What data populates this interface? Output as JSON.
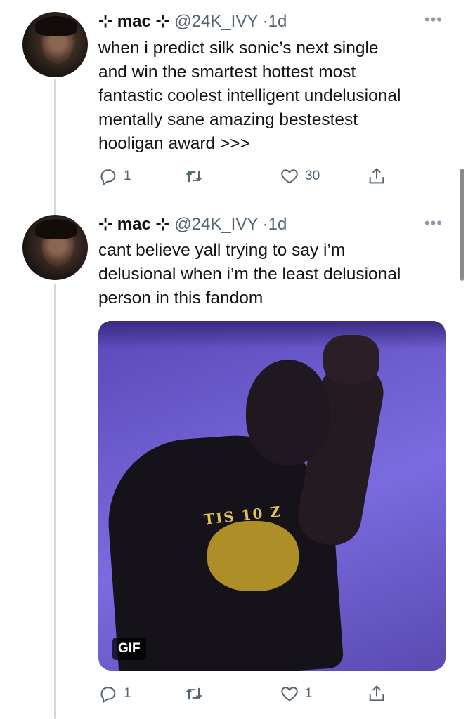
{
  "tweets": [
    {
      "name": "⊹ mac ⊹",
      "handle": "@24K_IVY",
      "separator": "·",
      "time": "1d",
      "more": "•••",
      "text": "when i predict silk sonic’s next single\nand win the smartest hottest most\nfantastic coolest intelligent undelusional\nmentally sane amazing bestestest\nhooligan award >>>",
      "replies": "1",
      "retweets": "",
      "likes": "30"
    },
    {
      "name": "⊹ mac ⊹",
      "handle": "@24K_IVY",
      "separator": "·",
      "time": "1d",
      "more": "•••",
      "text": "cant believe yall trying to say i’m\ndelusional when i’m the least delusional\nperson in this fandom",
      "media_badge": "GIF",
      "media_shirt_text": "TIS 10 Z",
      "replies": "1",
      "retweets": "",
      "likes": "1"
    }
  ],
  "colors": {
    "text": "#0f1419",
    "secondary": "#536471",
    "thread_line": "#cfd9de"
  },
  "icons": [
    "reply-icon",
    "retweet-icon",
    "like-icon",
    "share-icon",
    "more-icon"
  ]
}
